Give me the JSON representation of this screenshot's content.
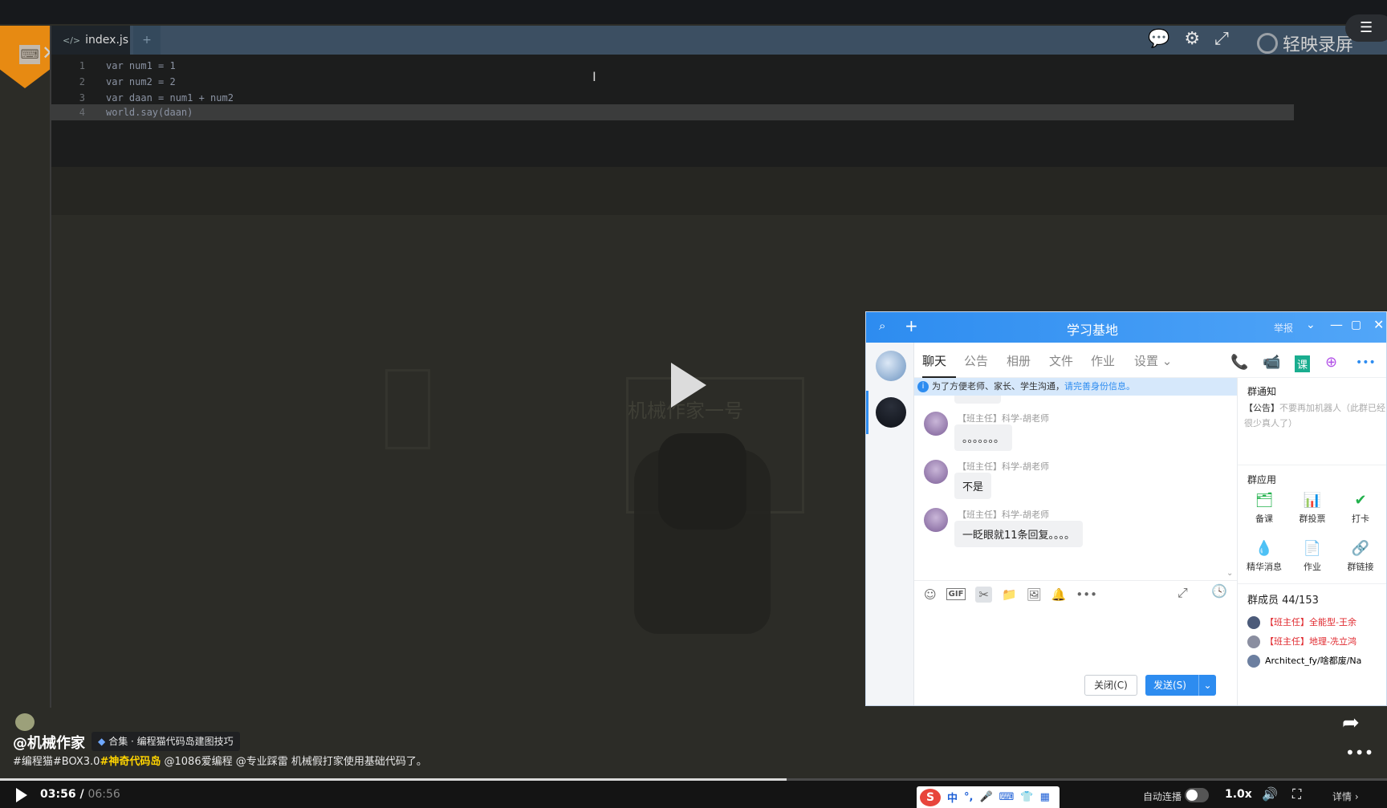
{
  "editor": {
    "tab_label": "index.js",
    "plus_label": "+",
    "lines": [
      {
        "num": "1",
        "code": "var num1 = 1"
      },
      {
        "num": "2",
        "code": "var num2 = 2"
      },
      {
        "num": "3",
        "code": "var daan = num1 + num2"
      },
      {
        "num": "4",
        "code": "world.say(daan)"
      }
    ],
    "cursor_glyph": "I"
  },
  "recorder": {
    "label": "轻映录屏"
  },
  "icons": {
    "code": "</>",
    "close": "✕",
    "chat": "💬",
    "bug": "⚙",
    "resize": "⤢",
    "menu": "☰",
    "share": "➦",
    "more": "•••",
    "volume": "🔊",
    "fullscreen": "⛶"
  },
  "video": {
    "sign_text": "机械作家一号",
    "author": "@机械作家",
    "collection": "合集 · 编程猫代码岛建图技巧",
    "description": {
      "tag1": "#编程猫#BOX3.0",
      "tag2": "#神奇代码岛",
      "rest": " @1086爱编程  @专业踩雷  机械假打家使用基础代码了。"
    },
    "current_time": "03:56",
    "separator": " / ",
    "duration": "06:56",
    "progress": 0.567,
    "autoplay_label": "自动连播",
    "speed": "1.0x",
    "details_label": "详情 ›"
  },
  "ime": {
    "logo": "S",
    "lang": "中",
    "punct": "°,",
    "mic": "🎤",
    "kbd": "⌨",
    "skin": "👕",
    "tools": "▦"
  },
  "chat": {
    "title": "学习基地",
    "report": "举报",
    "window_controls": {
      "search": "⌕",
      "plus": "+",
      "dropdown": "⌄",
      "min": "—",
      "max": "▢",
      "close": "✕"
    },
    "tabs": [
      "聊天",
      "公告",
      "相册",
      "文件",
      "作业",
      "设置 ⌄"
    ],
    "app_icons": [
      "📞",
      "📹",
      "课",
      "⊕",
      "•••"
    ],
    "notice": {
      "text": "为了方便老师、家长、学生沟通，",
      "link": "请完善身份信息。",
      "end": ""
    },
    "messages": [
      {
        "sender": "【班主任】科学-胡老师",
        "text": "。。。。。。。"
      },
      {
        "sender": "【班主任】科学-胡老师",
        "text": "不是"
      },
      {
        "sender": "【班主任】科学-胡老师",
        "text": "一眨眼就11条回复。。。。"
      }
    ],
    "toolbar": {
      "emoji": "☺",
      "gif": "GIF",
      "scissors": "✂",
      "folder": "📁",
      "image": "🖼",
      "bell": "🔔",
      "more": "•••",
      "expand": "⤢",
      "clock": "🕓"
    },
    "close_button": "关闭(C)",
    "send_button": "发送(S)",
    "send_arrow": "⌄",
    "right": {
      "notice_title": "群通知",
      "notice_prefix": "【公告】",
      "notice_body": "不要再加机器人（此群已经很少真人了）",
      "apps_title": "群应用",
      "apps": [
        {
          "icon": "🗂",
          "label": "备课"
        },
        {
          "icon": "📊",
          "label": "群投票"
        },
        {
          "icon": "✔",
          "label": "打卡"
        },
        {
          "icon": "💧",
          "label": "精华消息"
        },
        {
          "icon": "📄",
          "label": "作业"
        },
        {
          "icon": "🔗",
          "label": "群链接"
        }
      ],
      "members_title": "群成员 44/153",
      "members": [
        {
          "name": "【班主任】全能型-王余",
          "red": true
        },
        {
          "name": "【班主任】地理-冼立鸿",
          "red": true
        },
        {
          "name": "Architect_fy/啥都废/Na",
          "red": false
        }
      ]
    }
  },
  "colors": {
    "accent": "#2d8cf0",
    "tag_yellow": "#ffd400",
    "badge_orange": "#e78a12"
  }
}
